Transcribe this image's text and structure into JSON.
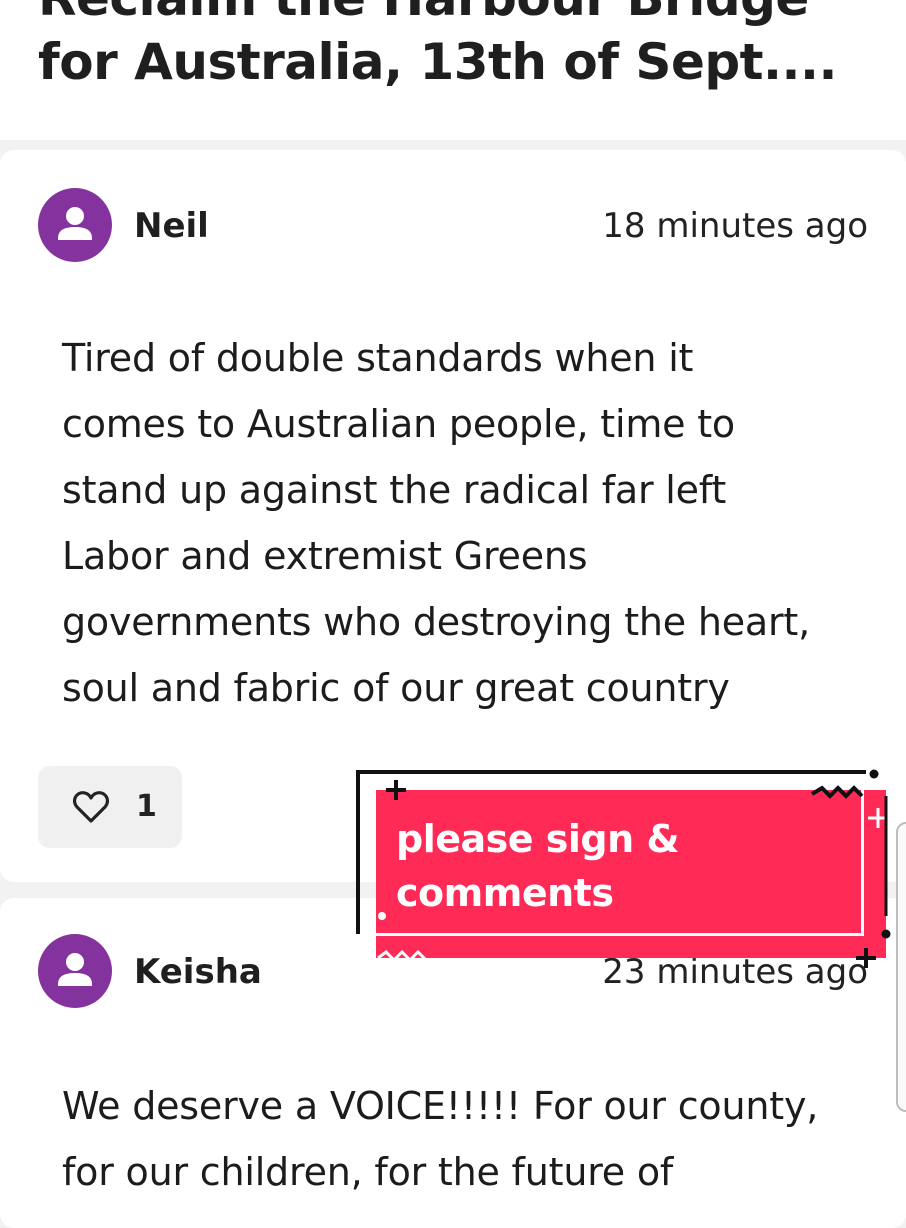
{
  "page": {
    "title_line1": "Reclaim the Harbour Bridge",
    "title_line2": "for Australia, 13th of Sept...."
  },
  "comments": [
    {
      "author": "Neil",
      "time": "18 minutes ago",
      "text": "Tired of double standards when it\ncomes to Australian people, time to\nstand up against the radical far left\nLabor and extremist Greens\ngovernments who destroying the heart,\nsoul and fabric of our great country",
      "likes": "1",
      "avatar_icon": "user-icon",
      "like_icon": "heart-icon"
    },
    {
      "author": "Keisha",
      "time": "23 minutes ago",
      "text": "We deserve a VOICE!!!!! For our county,\nfor our children, for the future of",
      "avatar_icon": "user-icon"
    }
  ],
  "sticker": {
    "text": "please sign &\ncomments"
  },
  "colors": {
    "avatar": "#84339e",
    "sticker": "#ff2a55",
    "background": "#f2f2f2",
    "card": "#ffffff"
  }
}
